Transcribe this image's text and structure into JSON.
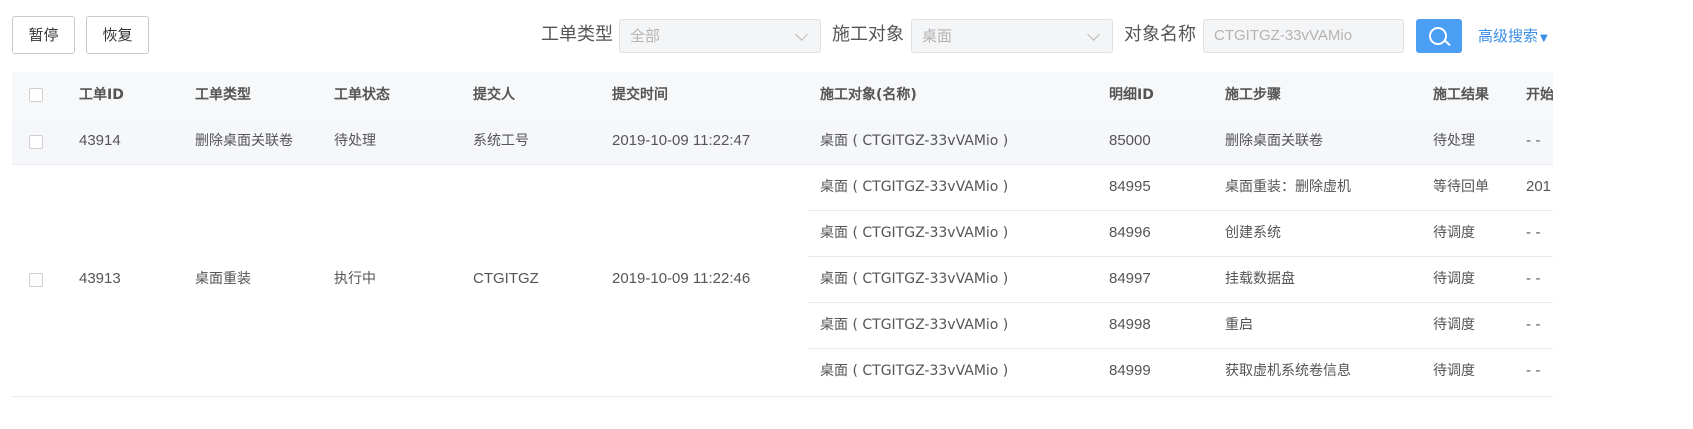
{
  "toolbar": {
    "pause_label": "暂停",
    "resume_label": "恢复"
  },
  "filters": {
    "type_label": "工单类型",
    "type_value": "全部",
    "target_label": "施工对象",
    "target_value": "桌面",
    "name_label": "对象名称",
    "name_placeholder": "CTGITGZ-33vVAMio",
    "advanced_label": "高级搜索"
  },
  "table": {
    "headers": [
      "工单ID",
      "工单类型",
      "工单状态",
      "提交人",
      "提交时间",
      "施工对象(名称)",
      "明细ID",
      "施工步骤",
      "施工结果",
      "开始"
    ],
    "orders": [
      {
        "id": "43914",
        "type": "删除桌面关联卷",
        "status": "待处理",
        "submitter": "系统工号",
        "time": "2019-10-09 11:22:47",
        "details": [
          {
            "target": "桌面 ( CTGITGZ-33vVAMio )",
            "detail_id": "85000",
            "step": "删除桌面关联卷",
            "result": "待处理",
            "start": "- -"
          }
        ]
      },
      {
        "id": "43913",
        "type": "桌面重装",
        "status": "执行中",
        "submitter": "CTGITGZ",
        "time": "2019-10-09 11:22:46",
        "details": [
          {
            "target": "桌面 ( CTGITGZ-33vVAMio )",
            "detail_id": "84995",
            "step": "桌面重装：删除虚机",
            "result": "等待回单",
            "start": "201"
          },
          {
            "target": "桌面 ( CTGITGZ-33vVAMio )",
            "detail_id": "84996",
            "step": "创建系统",
            "result": "待调度",
            "start": "- -"
          },
          {
            "target": "桌面 ( CTGITGZ-33vVAMio )",
            "detail_id": "84997",
            "step": "挂载数据盘",
            "result": "待调度",
            "start": "- -"
          },
          {
            "target": "桌面 ( CTGITGZ-33vVAMio )",
            "detail_id": "84998",
            "step": "重启",
            "result": "待调度",
            "start": "- -"
          },
          {
            "target": "桌面 ( CTGITGZ-33vVAMio )",
            "detail_id": "84999",
            "step": "获取虚机系统卷信息",
            "result": "待调度",
            "start": "- -"
          }
        ]
      }
    ]
  },
  "colors": {
    "accent": "#4a9ef4",
    "link": "#3a8ee6",
    "header_bg": "#f7f8fa",
    "row_highlight": "#f5f7fa",
    "border": "#e8eaed"
  }
}
